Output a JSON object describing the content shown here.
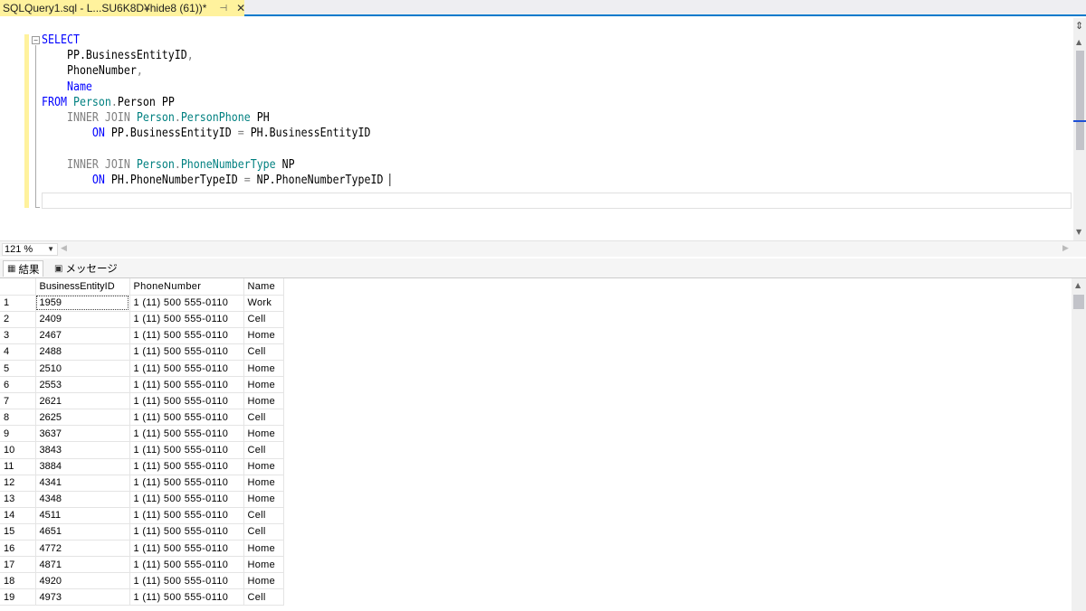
{
  "tab": {
    "title": "SQLQuery1.sql - L...SU6K8D¥hide8 (61))*",
    "pin": "⊣",
    "close": "✕"
  },
  "editor": {
    "lines": [
      [
        {
          "t": "SELECT",
          "c": "kw"
        }
      ],
      [
        {
          "t": "    ",
          "c": "blk"
        },
        {
          "t": "PP.BusinessEntityID",
          "c": "blk"
        },
        {
          "t": ",",
          "c": "kwg"
        }
      ],
      [
        {
          "t": "    ",
          "c": "blk"
        },
        {
          "t": "PhoneNumber",
          "c": "blk"
        },
        {
          "t": ",",
          "c": "kwg"
        }
      ],
      [
        {
          "t": "    ",
          "c": "blk"
        },
        {
          "t": "Name",
          "c": "kw"
        }
      ],
      [
        {
          "t": "FROM",
          "c": "kw"
        },
        {
          "t": " ",
          "c": "blk"
        },
        {
          "t": "Person",
          "c": "obj"
        },
        {
          "t": ".",
          "c": "kwg"
        },
        {
          "t": "Person PP",
          "c": "blk"
        }
      ],
      [
        {
          "t": "    ",
          "c": "blk"
        },
        {
          "t": "INNER JOIN",
          "c": "kwg"
        },
        {
          "t": " ",
          "c": "blk"
        },
        {
          "t": "Person",
          "c": "obj"
        },
        {
          "t": ".",
          "c": "kwg"
        },
        {
          "t": "PersonPhone",
          "c": "obj"
        },
        {
          "t": " PH",
          "c": "blk"
        }
      ],
      [
        {
          "t": "        ",
          "c": "blk"
        },
        {
          "t": "ON",
          "c": "kw"
        },
        {
          "t": " PP.BusinessEntityID ",
          "c": "blk"
        },
        {
          "t": "=",
          "c": "kwg"
        },
        {
          "t": " PH.BusinessEntityID",
          "c": "blk"
        }
      ],
      [
        {
          "t": "",
          "c": "blk"
        }
      ],
      [
        {
          "t": "    ",
          "c": "blk"
        },
        {
          "t": "INNER JOIN",
          "c": "kwg"
        },
        {
          "t": " ",
          "c": "blk"
        },
        {
          "t": "Person",
          "c": "obj"
        },
        {
          "t": ".",
          "c": "kwg"
        },
        {
          "t": "PhoneNumberType",
          "c": "obj"
        },
        {
          "t": " NP",
          "c": "blk"
        }
      ],
      [
        {
          "t": "        ",
          "c": "blk"
        },
        {
          "t": "ON",
          "c": "kw"
        },
        {
          "t": " PH.PhoneNumberTypeID ",
          "c": "blk"
        },
        {
          "t": "=",
          "c": "kwg"
        },
        {
          "t": " NP.PhoneNumberTypeID ",
          "c": "blk"
        }
      ]
    ]
  },
  "zoom": {
    "value": "121 %"
  },
  "results_tabs": {
    "results": "結果",
    "messages": "メッセージ"
  },
  "grid": {
    "columns": [
      "",
      "BusinessEntityID",
      "PhoneNumber",
      "Name"
    ],
    "rows": [
      [
        "1",
        "1959",
        "1 (11) 500 555-0110",
        "Work"
      ],
      [
        "2",
        "2409",
        "1 (11) 500 555-0110",
        "Cell"
      ],
      [
        "3",
        "2467",
        "1 (11) 500 555-0110",
        "Home"
      ],
      [
        "4",
        "2488",
        "1 (11) 500 555-0110",
        "Cell"
      ],
      [
        "5",
        "2510",
        "1 (11) 500 555-0110",
        "Home"
      ],
      [
        "6",
        "2553",
        "1 (11) 500 555-0110",
        "Home"
      ],
      [
        "7",
        "2621",
        "1 (11) 500 555-0110",
        "Home"
      ],
      [
        "8",
        "2625",
        "1 (11) 500 555-0110",
        "Cell"
      ],
      [
        "9",
        "3637",
        "1 (11) 500 555-0110",
        "Home"
      ],
      [
        "10",
        "3843",
        "1 (11) 500 555-0110",
        "Cell"
      ],
      [
        "11",
        "3884",
        "1 (11) 500 555-0110",
        "Home"
      ],
      [
        "12",
        "4341",
        "1 (11) 500 555-0110",
        "Home"
      ],
      [
        "13",
        "4348",
        "1 (11) 500 555-0110",
        "Home"
      ],
      [
        "14",
        "4511",
        "1 (11) 500 555-0110",
        "Cell"
      ],
      [
        "15",
        "4651",
        "1 (11) 500 555-0110",
        "Cell"
      ],
      [
        "16",
        "4772",
        "1 (11) 500 555-0110",
        "Home"
      ],
      [
        "17",
        "4871",
        "1 (11) 500 555-0110",
        "Home"
      ],
      [
        "18",
        "4920",
        "1 (11) 500 555-0110",
        "Home"
      ],
      [
        "19",
        "4973",
        "1 (11) 500 555-0110",
        "Cell"
      ]
    ]
  },
  "colors": {
    "accent": "#007acc",
    "tab_bg": "#fff29d",
    "keyword": "#0000ff",
    "object": "#008080",
    "operator": "#808080"
  }
}
